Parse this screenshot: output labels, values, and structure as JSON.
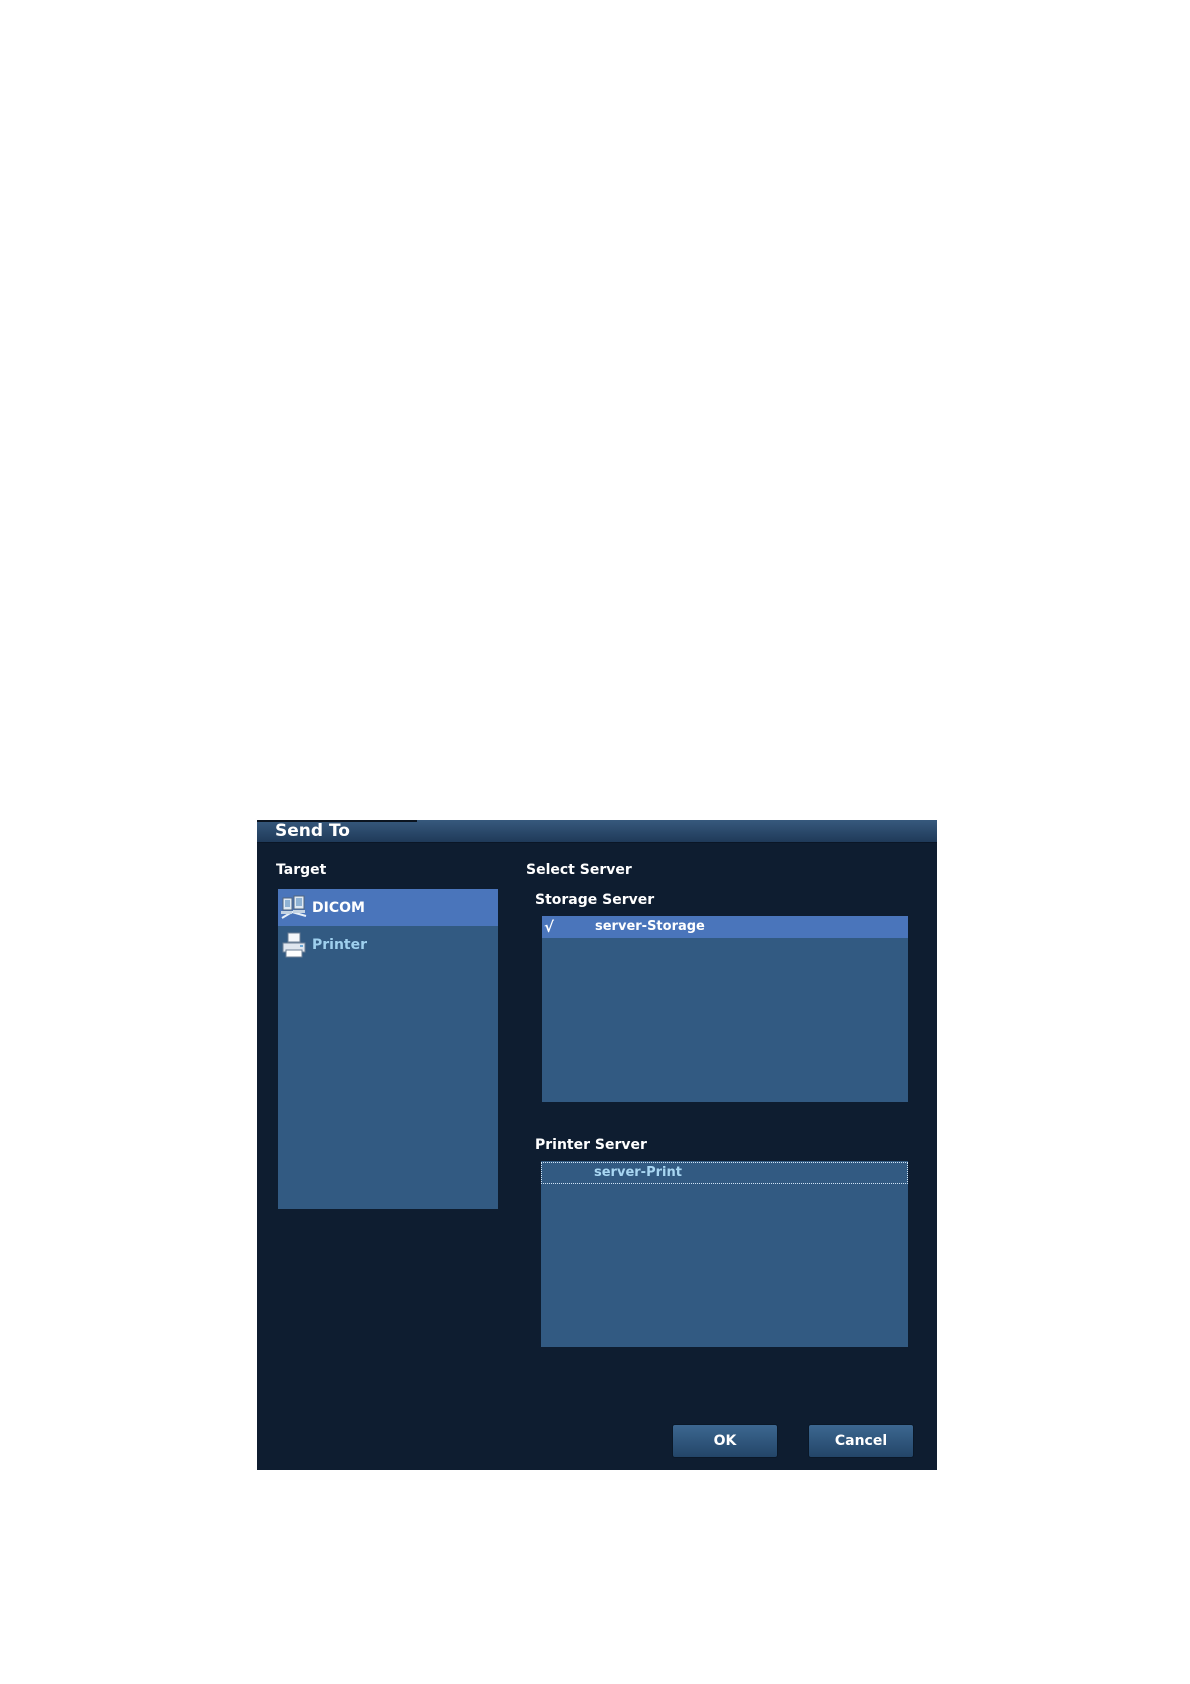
{
  "dialog": {
    "title": "Send To"
  },
  "target": {
    "label": "Target",
    "items": [
      {
        "label": "DICOM",
        "icon": "dicom-network-icon",
        "selected": true
      },
      {
        "label": "Printer",
        "icon": "printer-icon",
        "selected": false
      }
    ]
  },
  "select_server": {
    "label": "Select Server",
    "storage": {
      "label": "Storage Server",
      "rows": [
        {
          "check": "√",
          "name": "server-Storage",
          "selected": true
        }
      ]
    },
    "printer": {
      "label": "Printer Server",
      "rows": [
        {
          "check": "",
          "name": "server-Print",
          "focused": true
        }
      ]
    }
  },
  "buttons": {
    "ok": "OK",
    "cancel": "Cancel"
  },
  "colors": {
    "dialog_bg": "#0e1d30",
    "list_bg": "#325a82",
    "selection": "#4a75bb",
    "unselected_text": "#9fd0ee"
  }
}
